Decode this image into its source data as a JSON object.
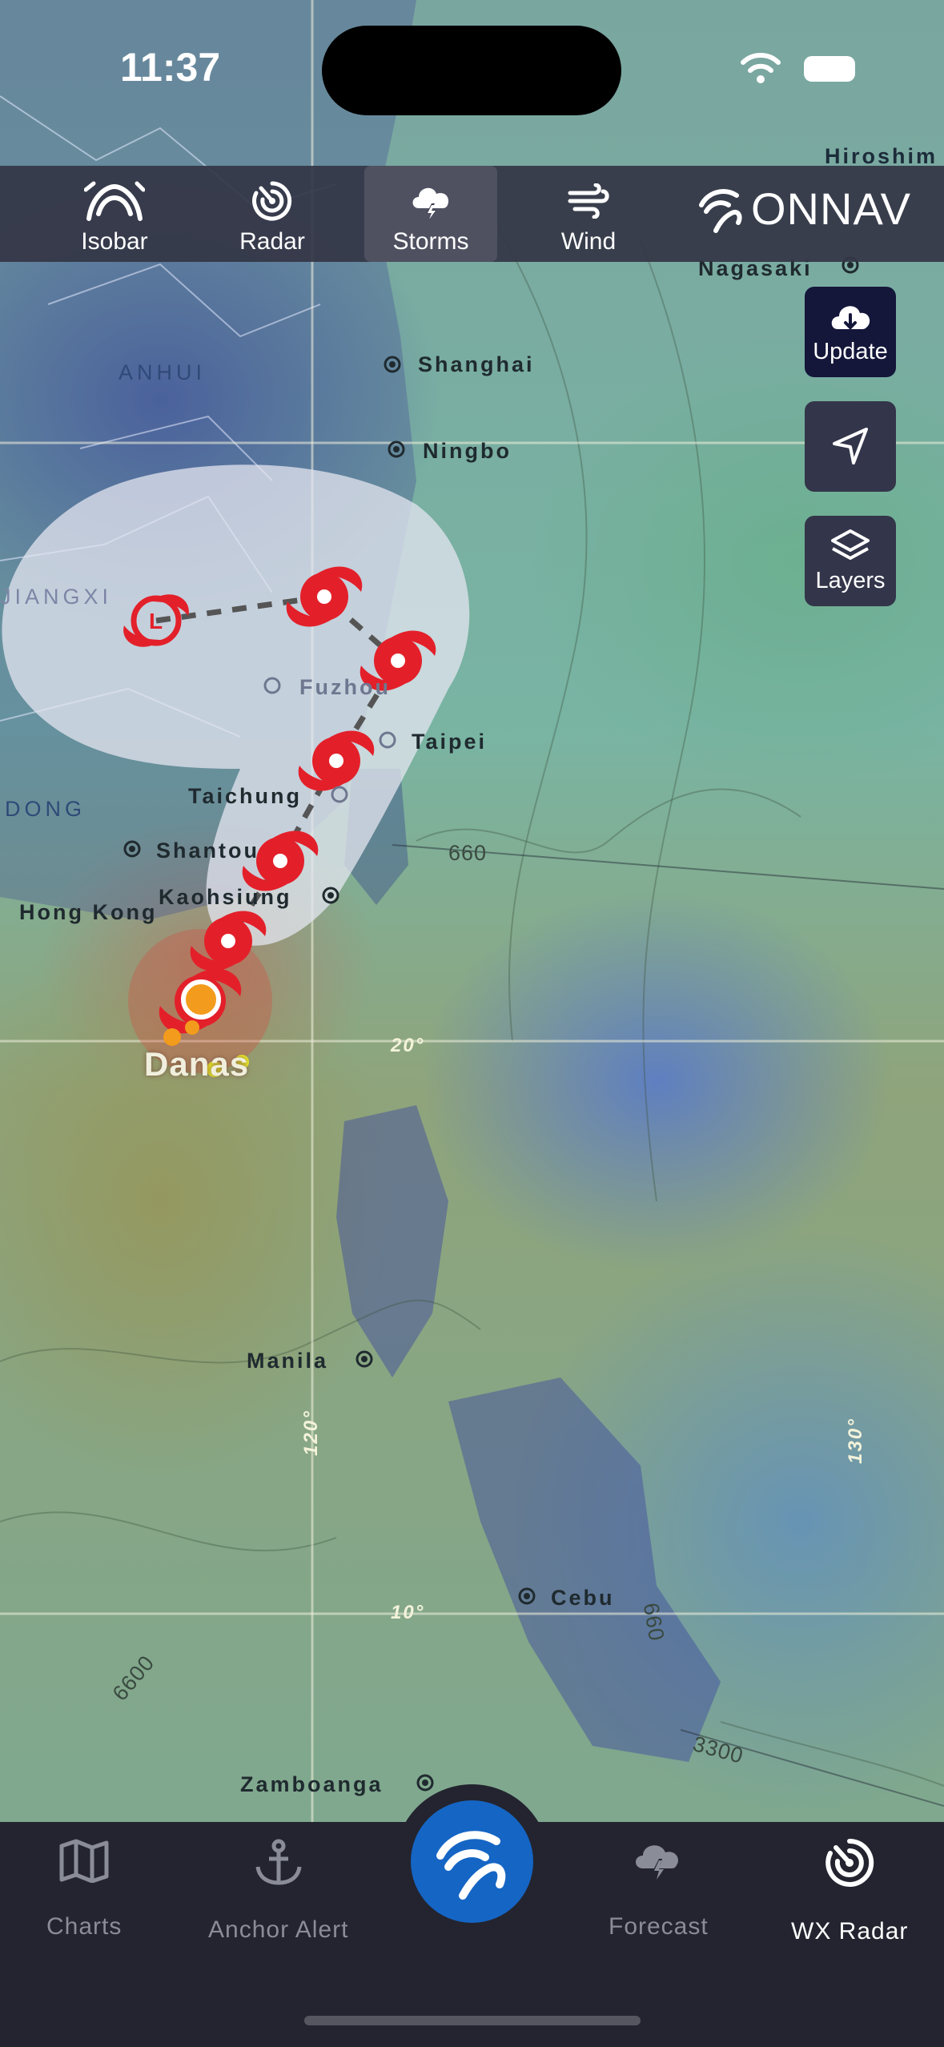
{
  "status_bar": {
    "time": "11:37"
  },
  "top_toolbar": {
    "items": [
      {
        "label": "Isobar",
        "icon": "isobar-icon"
      },
      {
        "label": "Radar",
        "icon": "radar-icon"
      },
      {
        "label": "Storms",
        "icon": "storm-cloud-icon",
        "active": true
      },
      {
        "label": "Wind",
        "icon": "wind-icon"
      }
    ],
    "brand": "ONNAV"
  },
  "side_buttons": {
    "update": "Update",
    "locate_icon": "location-arrow-icon",
    "layers": "Layers"
  },
  "map": {
    "cities": [
      "Nagasaki",
      "Shanghai",
      "Ningbo",
      "Fuzhou",
      "Taipei",
      "Taichung",
      "Shantou",
      "Hong Kong",
      "Kaohsiung",
      "Manila",
      "Cebu",
      "Zamboanga",
      "Hiroshim"
    ],
    "regions": [
      "ANHUI",
      "JIANGXI",
      "DONG"
    ],
    "storm_name": "Danas",
    "grid_labels": [
      "20°",
      "10°",
      "120°",
      "130°"
    ],
    "contour_labels": [
      "660",
      "6600",
      "3300",
      "660"
    ],
    "colors": {
      "storm": "#e3202a",
      "cone": "#e4e6ee",
      "current_position": "#f39b1c"
    }
  },
  "bottom_tabs": {
    "items": [
      {
        "label": "Charts",
        "icon": "map-icon"
      },
      {
        "label": "Anchor Alert",
        "icon": "anchor-icon"
      },
      {
        "label": "Forecast",
        "icon": "storm-cloud-icon"
      },
      {
        "label": "WX Radar",
        "icon": "radar-icon",
        "active": true
      }
    ],
    "center_icon": "onnav-logo-icon"
  }
}
